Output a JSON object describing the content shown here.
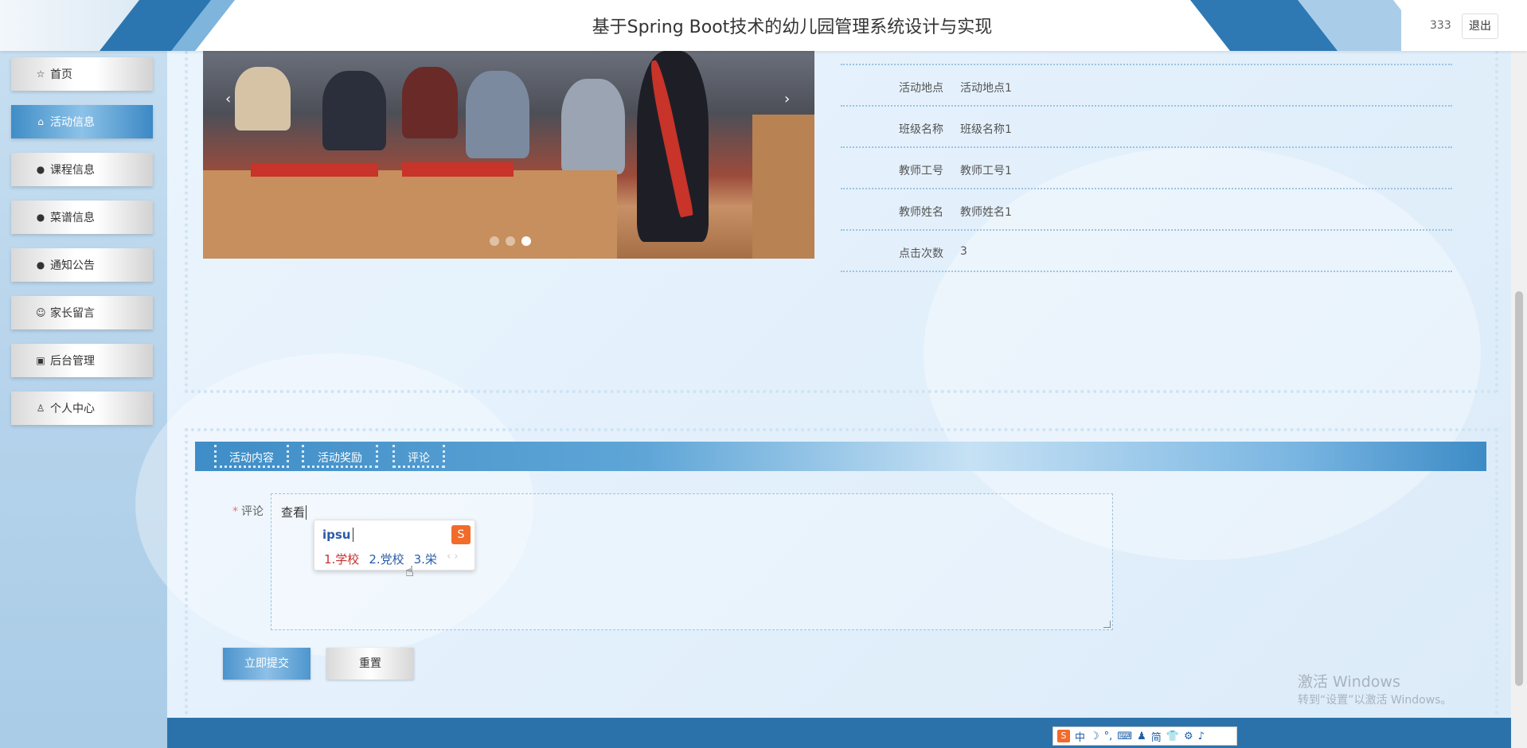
{
  "header": {
    "title": "基于Spring Boot技术的幼儿园管理系统设计与实现",
    "username": "333",
    "logout_label": "退出"
  },
  "sidebar": {
    "items": [
      {
        "label": "首页",
        "icon": "star-icon",
        "active": false
      },
      {
        "label": "活动信息",
        "icon": "lock-icon",
        "active": true
      },
      {
        "label": "课程信息",
        "icon": "exclamation-circle-icon",
        "active": false
      },
      {
        "label": "菜谱信息",
        "icon": "question-circle-icon",
        "active": false
      },
      {
        "label": "通知公告",
        "icon": "info-circle-icon",
        "active": false
      },
      {
        "label": "家长留言",
        "icon": "smile-icon",
        "active": false
      },
      {
        "label": "后台管理",
        "icon": "briefcase-icon",
        "active": false
      },
      {
        "label": "个人中心",
        "icon": "user-icon",
        "active": false
      }
    ]
  },
  "carousel": {
    "prev_label": "‹",
    "next_label": "›",
    "slide_count": 3,
    "active_index": 2
  },
  "details": [
    {
      "label": "活动地点",
      "value": "活动地点1"
    },
    {
      "label": "班级名称",
      "value": "班级名称1"
    },
    {
      "label": "教师工号",
      "value": "教师工号1"
    },
    {
      "label": "教师姓名",
      "value": "教师姓名1"
    },
    {
      "label": "点击次数",
      "value": "3"
    }
  ],
  "tabs": [
    {
      "label": "活动内容"
    },
    {
      "label": "活动奖励"
    },
    {
      "label": "评论"
    }
  ],
  "comment_form": {
    "required_mark": "*",
    "label": "评论",
    "value": "查看"
  },
  "ime": {
    "input": "ipsu",
    "logo": "S",
    "candidates": [
      "1.学校",
      "2.党校",
      "3.栄"
    ],
    "nav": "‹ ›"
  },
  "buttons": {
    "submit_label": "立即提交",
    "reset_label": "重置"
  },
  "watermark": {
    "line1": "激活 Windows",
    "line2": "转到“设置”以激活 Windows。"
  },
  "ime_toolbar": {
    "items": [
      "中",
      "☽",
      "°,",
      "⌨",
      "♟",
      "简",
      "👕",
      "⚙",
      "♪"
    ]
  },
  "colors": {
    "accent": "#3f8dc7",
    "footer": "#2c72aa",
    "required": "#f56c6c"
  }
}
